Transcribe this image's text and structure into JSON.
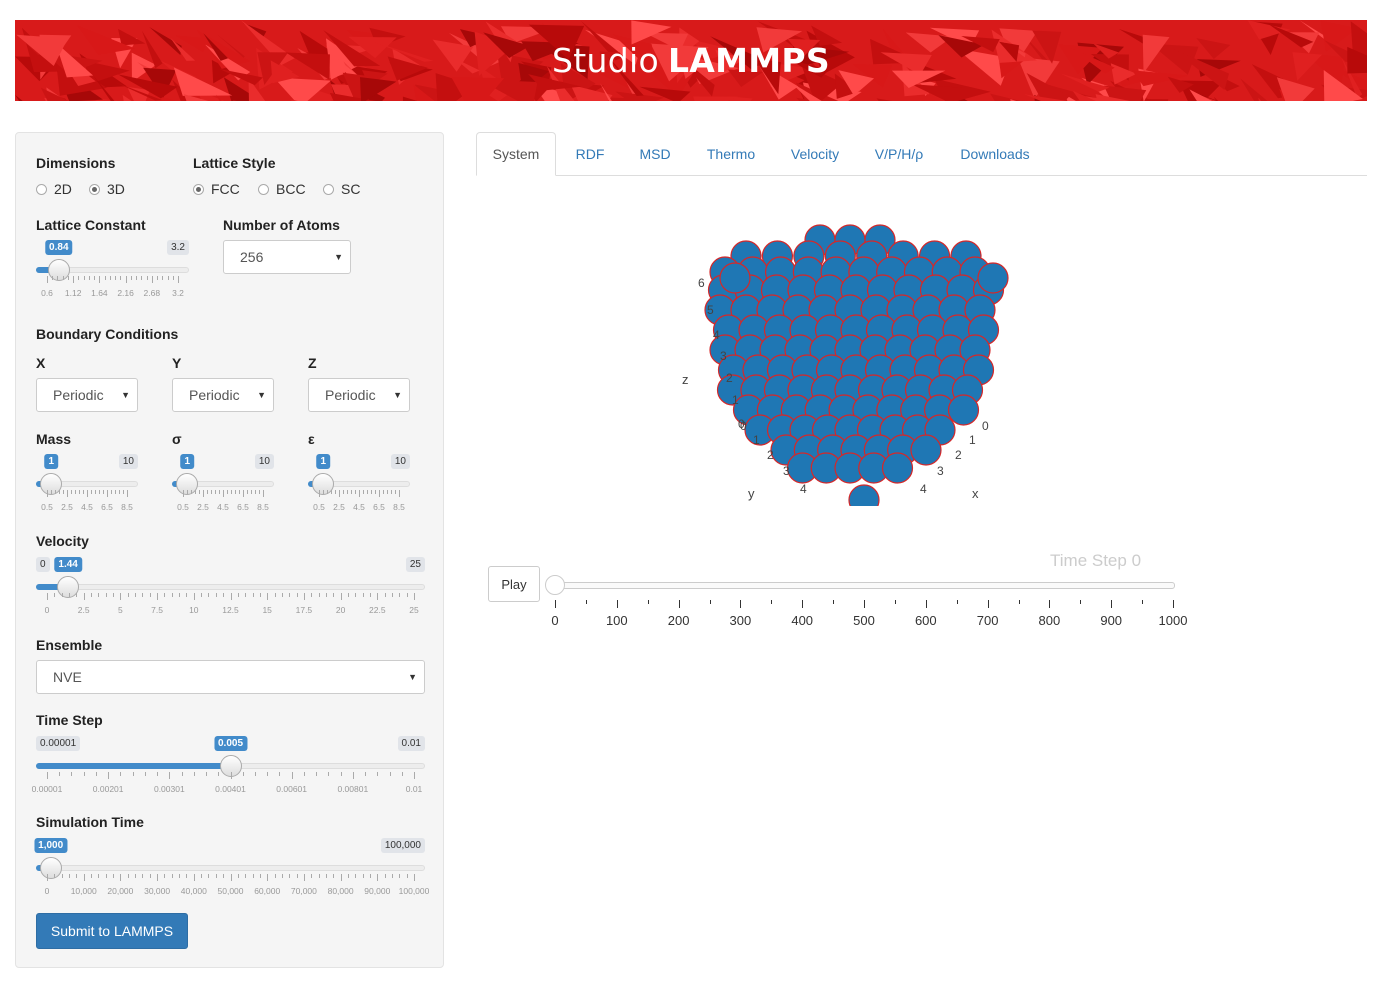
{
  "banner": {
    "title_light": "Studio",
    "title_bold": "LAMMPS"
  },
  "sidebar": {
    "dimensions": {
      "label": "Dimensions",
      "options": [
        "2D",
        "3D"
      ],
      "selected": "3D"
    },
    "lattice_style": {
      "label": "Lattice Style",
      "options": [
        "FCC",
        "BCC",
        "SC"
      ],
      "selected": "FCC"
    },
    "lattice_constant": {
      "label": "Lattice Constant",
      "value": "0.84",
      "min": "0.6",
      "max": "3.2",
      "fraction": 0.09,
      "ticks": [
        "0.6",
        "1.12",
        "1.64",
        "2.16",
        "2.68",
        "3.2"
      ]
    },
    "number_of_atoms": {
      "label": "Number of Atoms",
      "value": "256"
    },
    "boundary_conditions": {
      "label": "Boundary Conditions",
      "x": {
        "label": "X",
        "value": "Periodic"
      },
      "y": {
        "label": "Y",
        "value": "Periodic"
      },
      "z": {
        "label": "Z",
        "value": "Periodic"
      }
    },
    "mass": {
      "label": "Mass",
      "value": "1",
      "min": "0.5",
      "max": "10",
      "fraction": 0.053,
      "ticks": [
        "0.5",
        "2.5",
        "4.5",
        "6.5",
        "8.5"
      ]
    },
    "sigma": {
      "label": "σ",
      "value": "1",
      "min": "0.5",
      "max": "10",
      "fraction": 0.053,
      "ticks": [
        "0.5",
        "2.5",
        "4.5",
        "6.5",
        "8.5"
      ]
    },
    "epsilon": {
      "label": "ε",
      "value": "1",
      "min": "0.5",
      "max": "10",
      "fraction": 0.053,
      "ticks": [
        "0.5",
        "2.5",
        "4.5",
        "6.5",
        "8.5"
      ]
    },
    "velocity": {
      "label": "Velocity",
      "value": "1.44",
      "min": "0",
      "max": "25",
      "fraction": 0.0576,
      "ticks": [
        "0",
        "2.5",
        "5",
        "7.5",
        "10",
        "12.5",
        "15",
        "17.5",
        "20",
        "22.5",
        "25"
      ]
    },
    "ensemble": {
      "label": "Ensemble",
      "value": "NVE"
    },
    "time_step": {
      "label": "Time Step",
      "value": "0.005",
      "min": "0.00001",
      "max": "0.01",
      "fraction": 0.5,
      "ticks": [
        "0.00001",
        "0.00201",
        "0.00301",
        "0.00401",
        "0.00601",
        "0.00801",
        "0.01"
      ]
    },
    "simulation_time": {
      "label": "Simulation Time",
      "value": "1,000",
      "min": "0",
      "max": "100,000",
      "fraction": 0.01,
      "ticks": [
        "0",
        "10,000",
        "20,000",
        "30,000",
        "40,000",
        "50,000",
        "60,000",
        "70,000",
        "80,000",
        "90,000",
        "100,000"
      ]
    },
    "submit_label": "Submit to LAMMPS"
  },
  "tabs": [
    "System",
    "RDF",
    "MSD",
    "Thermo",
    "Velocity",
    "V/P/H/ρ",
    "Downloads"
  ],
  "active_tab": "System",
  "system_plot": {
    "z_axis": {
      "title": "z",
      "ticks": [
        "0",
        "1",
        "2",
        "3",
        "4",
        "5",
        "6"
      ]
    },
    "y_axis": {
      "title": "y",
      "ticks": [
        "0",
        "1",
        "2",
        "3",
        "4"
      ]
    },
    "x_axis": {
      "title": "x",
      "ticks": [
        "0",
        "1",
        "2",
        "3",
        "4"
      ]
    },
    "atom_color": "#1f77b4",
    "atom_outline": "#d62728"
  },
  "timestep_slider": {
    "play_label": "Play",
    "label": "Time Step 0",
    "value": 0,
    "ticks": [
      "0",
      "100",
      "200",
      "300",
      "400",
      "500",
      "600",
      "700",
      "800",
      "900",
      "1000"
    ]
  },
  "colors": {
    "accent": "#337ab7",
    "badge": "#428bca",
    "banner": "#d81a1a"
  }
}
